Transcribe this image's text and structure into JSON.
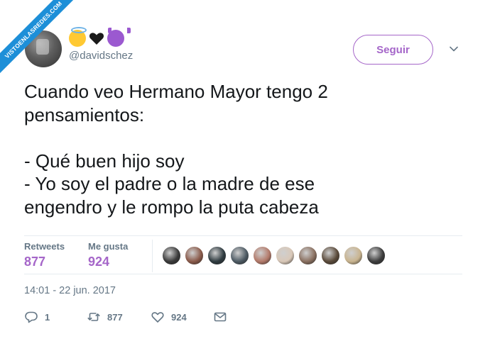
{
  "watermark": {
    "text": "VISTOENLASREDES.COM"
  },
  "user": {
    "handle": "@davidschez",
    "emojis": [
      "smiling-face-with-halo",
      "black-heart",
      "smiling-face-with-horns"
    ]
  },
  "follow_button": {
    "label": "Seguir"
  },
  "tweet": {
    "lines": [
      "Cuando veo Hermano Mayor tengo 2",
      "pensamientos:",
      "",
      "- Qué buen hijo soy",
      "- Yo soy el padre o la madre de ese",
      "engendro y le rompo la puta cabeza"
    ]
  },
  "stats": {
    "retweets_label": "Retweets",
    "retweets_value": "877",
    "likes_label": "Me gusta",
    "likes_value": "924"
  },
  "likers": {
    "colors": [
      "#3a3a3a",
      "#8a5a4a",
      "#2f3b40",
      "#4d5a63",
      "#b37a6a",
      "#d9c8b8",
      "#8a7060",
      "#5a4a3a",
      "#c9b48f",
      "#3d3d3d"
    ]
  },
  "timestamp": "14:01 - 22 jun. 2017",
  "actions": {
    "reply_count": "1",
    "retweet_count": "877",
    "like_count": "924"
  },
  "colors": {
    "accent": "#a566c9",
    "secondary_text": "#657786",
    "watermark_bg": "#1d8fd8"
  }
}
